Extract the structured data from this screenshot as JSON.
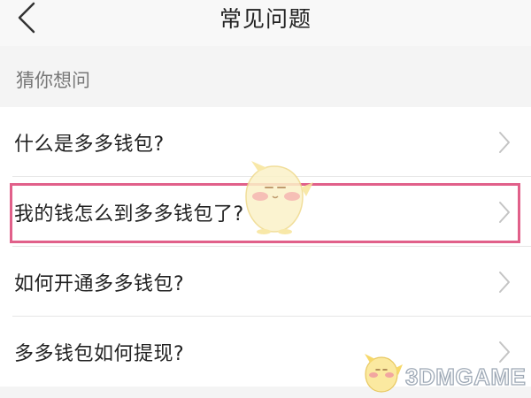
{
  "header": {
    "title": "常见问题",
    "back_icon": "chevron-left-icon"
  },
  "section": {
    "label": "猜你想问"
  },
  "items": [
    {
      "label": "什么是多多钱包?",
      "icon": "chevron-right-icon"
    },
    {
      "label": "我的钱怎么到多多钱包了?",
      "icon": "chevron-right-icon",
      "highlighted": true
    },
    {
      "label": "如何开通多多钱包?",
      "icon": "chevron-right-icon"
    },
    {
      "label": "多多钱包如何提现?",
      "icon": "chevron-right-icon"
    }
  ],
  "watermark": {
    "text": "3DMGAME"
  },
  "colors": {
    "highlight": "#e1608a",
    "background": "#f4f4f4",
    "list_background": "#ffffff",
    "label_gray": "#777777"
  }
}
